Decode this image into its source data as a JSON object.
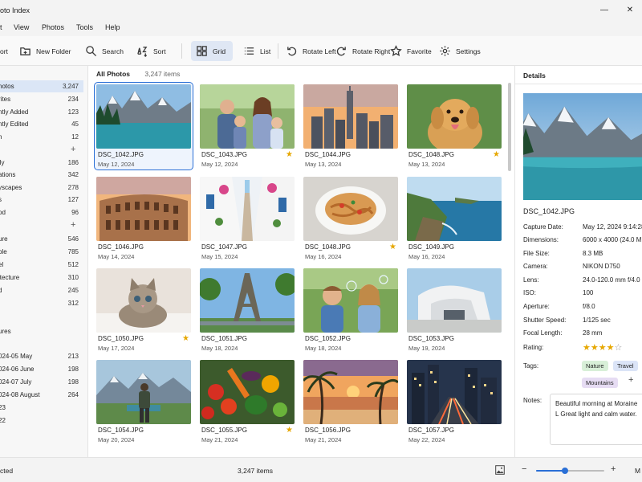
{
  "window": {
    "title": "oto Index",
    "minimize": "—",
    "close": "✕"
  },
  "menu": [
    "t",
    "View",
    "Photos",
    "Tools",
    "Help"
  ],
  "toolbar": {
    "buttons": [
      "ort",
      "New Folder",
      "Search",
      "Sort",
      "Grid",
      "List",
      "Rotate Left",
      "Rotate Right",
      "Favorite",
      "Settings"
    ],
    "active": "Grid"
  },
  "sidebar": {
    "library": [
      {
        "label": "hotos",
        "count": "3,247",
        "selected": true
      },
      {
        "label": "rites",
        "count": "234"
      },
      {
        "label": "ntly Added",
        "count": "123"
      },
      {
        "label": "ntly Edited",
        "count": "45"
      },
      {
        "label": "h",
        "count": "12"
      }
    ],
    "albums": [
      {
        "label": "ily",
        "count": "186"
      },
      {
        "label": "ations",
        "count": "342"
      },
      {
        "label": "yscapes",
        "count": "278"
      },
      {
        "label": "s",
        "count": "127"
      },
      {
        "label": "od",
        "count": "96"
      }
    ],
    "tags": [
      {
        "label": "ure",
        "count": "546"
      },
      {
        "label": "ple",
        "count": "785"
      },
      {
        "label": "el",
        "count": "512"
      },
      {
        "label": "itecture",
        "count": "310"
      },
      {
        "label": "d",
        "count": "245"
      },
      {
        "label": "",
        "count": "312"
      }
    ],
    "dates": [
      {
        "label": "ures",
        "count": ""
      },
      {
        "label": "024-05 May",
        "count": "213"
      },
      {
        "label": "024-06 June",
        "count": "198"
      },
      {
        "label": "024-07 July",
        "count": "198"
      },
      {
        "label": "024-08 August",
        "count": "264"
      },
      {
        "label": "23",
        "count": ""
      },
      {
        "label": "22",
        "count": ""
      }
    ]
  },
  "content": {
    "title": "All Photos",
    "count": "3,247 items",
    "photos": [
      {
        "name": "DSC_1042.JPG",
        "date": "May 12, 2024",
        "fav": false,
        "scene": "lake-mountains",
        "selected": true
      },
      {
        "name": "DSC_1043.JPG",
        "date": "May 12, 2024",
        "fav": true,
        "scene": "family"
      },
      {
        "name": "DSC_1044.JPG",
        "date": "May 13, 2024",
        "fav": false,
        "scene": "city-sunset"
      },
      {
        "name": "DSC_1048.JPG",
        "date": "May 13, 2024",
        "fav": true,
        "scene": "dog"
      },
      {
        "name": "DSC_1046.JPG",
        "date": "May 14, 2024",
        "fav": false,
        "scene": "colosseum"
      },
      {
        "name": "DSC_1047.JPG",
        "date": "May 15, 2024",
        "fav": false,
        "scene": "alley"
      },
      {
        "name": "DSC_1048.JPG",
        "date": "May 16, 2024",
        "fav": true,
        "scene": "pasta"
      },
      {
        "name": "DSC_1049.JPG",
        "date": "May 16, 2024",
        "fav": false,
        "scene": "coast"
      },
      {
        "name": "DSC_1050.JPG",
        "date": "May 17, 2024",
        "fav": true,
        "scene": "kitten"
      },
      {
        "name": "DSC_1051.JPG",
        "date": "May 18, 2024",
        "fav": false,
        "scene": "eiffel"
      },
      {
        "name": "DSC_1052.JPG",
        "date": "May 18, 2024",
        "fav": false,
        "scene": "kids-bubbles"
      },
      {
        "name": "DSC_1053.JPG",
        "date": "May 19, 2024",
        "fav": false,
        "scene": "building"
      },
      {
        "name": "DSC_1054.JPG",
        "date": "May 20, 2024",
        "fav": false,
        "scene": "hiker"
      },
      {
        "name": "DSC_1055.JPG",
        "date": "May 21, 2024",
        "fav": true,
        "scene": "vegetables"
      },
      {
        "name": "DSC_1056.JPG",
        "date": "May 21, 2024",
        "fav": false,
        "scene": "palm-beach"
      },
      {
        "name": "DSC_1057.JPG",
        "date": "May 22, 2024",
        "fav": false,
        "scene": "city-night"
      }
    ]
  },
  "details": {
    "title": "Details",
    "filename": "DSC_1042.JPG",
    "rows": [
      {
        "k": "Capture Date:",
        "v": "May 12, 2024   9:14:28"
      },
      {
        "k": "Dimensions:",
        "v": "6000 x 4000 (24.0 M"
      },
      {
        "k": "File Size:",
        "v": "8.3 MB"
      },
      {
        "k": "Camera:",
        "v": "NIKON D750"
      },
      {
        "k": "Lens:",
        "v": "24.0-120.0 mm f/4.0"
      },
      {
        "k": "ISO:",
        "v": "100"
      },
      {
        "k": "Aperture:",
        "v": "f/8.0"
      },
      {
        "k": "Shutter Speed:",
        "v": "1/125 sec"
      },
      {
        "k": "Focal Length:",
        "v": "28 mm"
      }
    ],
    "rating_label": "Rating:",
    "rating": 4,
    "rating_max": 5,
    "tags_label": "Tags:",
    "tags": [
      {
        "label": "Nature",
        "color": "#d8efd8"
      },
      {
        "label": "Travel",
        "color": "#dbe4f7"
      },
      {
        "label": "Mountains",
        "color": "#e6dcf3"
      }
    ],
    "notes_label": "Notes:",
    "notes": "Beautiful morning at Moraine L Great light and calm water."
  },
  "status": {
    "left": "cted",
    "center": "3,247 items",
    "zoom_minus": "−",
    "zoom_plus": "+",
    "zoom_level": 0.42,
    "right": "M"
  },
  "colors": {
    "accent": "#2a6fd6",
    "star": "#e6a700",
    "selection": "#dbe6f6"
  }
}
